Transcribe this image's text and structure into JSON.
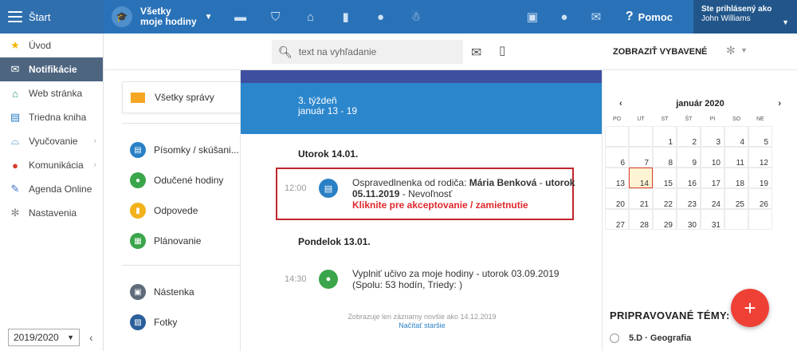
{
  "topbar": {
    "start_label": "Štart",
    "subject_line1": "Všetky",
    "subject_line2": "moje hodiny",
    "help_label": "Pomoc",
    "user_line1": "Ste prihlásený ako",
    "user_line2": "John Williams"
  },
  "sidebar": {
    "items": [
      {
        "label": "Úvod",
        "icon": "star-icon"
      },
      {
        "label": "Notifikácie",
        "icon": "envelope-icon"
      },
      {
        "label": "Web stránka",
        "icon": "home-icon"
      },
      {
        "label": "Triedna kniha",
        "icon": "book-icon"
      },
      {
        "label": "Vyučovanie",
        "icon": "bridge-icon"
      },
      {
        "label": "Komunikácia",
        "icon": "chat-icon"
      },
      {
        "label": "Agenda Online",
        "icon": "pen-icon"
      },
      {
        "label": "Nastavenia",
        "icon": "gear-icon"
      }
    ],
    "year": "2019/2020"
  },
  "subheader": {
    "search_placeholder": "text na vyhľadanie",
    "show_equipment": "ZOBRAZIŤ VYBAVENÉ"
  },
  "categories": {
    "all_messages": "Všetky správy",
    "items": [
      {
        "label": "Písomky / skúšani...",
        "color": "#2a80c5"
      },
      {
        "label": "Odučené hodiny",
        "color": "#3aa54a"
      },
      {
        "label": "Odpovede",
        "color": "#f2b21c"
      },
      {
        "label": "Plánovanie",
        "color": "#3aa54a"
      },
      {
        "label": "Nástenka",
        "color": "#5e6b78"
      },
      {
        "label": "Fotky",
        "color": "#2a5f9a"
      }
    ]
  },
  "feed": {
    "week_label": "3. týždeň",
    "week_range": "január 13 - 19",
    "days": [
      {
        "title": "Utorok 14.01.",
        "entry": {
          "time": "12:00",
          "text_prefix": "Ospravedlnenka od rodiča: ",
          "name": "Mária Benková",
          "text_mid": " - ",
          "date": "utorok 05.11.2019",
          "text_suffix": " - Nevoľnosť",
          "action": "Kliknite pre akceptovanie / zamietnutie"
        }
      },
      {
        "title": "Pondelok 13.01.",
        "entry": {
          "time": "14:30",
          "text": "Vyplniť učivo za moje hodiny - utorok 03.09.2019 (Spolu: 53 hodín, Triedy: )"
        }
      }
    ],
    "notice": "Zobrazuje len záznamy novšie ako 14.12.2019",
    "load_older": "Načítať staršie"
  },
  "calendar": {
    "month": "január 2020",
    "prev": "‹",
    "next": "›",
    "weekdays": [
      "PO",
      "UT",
      "ST",
      "ŠT",
      "PI",
      "SO",
      "NE"
    ],
    "weeks": [
      [
        "",
        "",
        "1",
        "2",
        "3",
        "4",
        "5"
      ],
      [
        "6",
        "7",
        "8",
        "9",
        "10",
        "11",
        "12"
      ],
      [
        "13",
        "14",
        "15",
        "16",
        "17",
        "18",
        "19"
      ],
      [
        "20",
        "21",
        "22",
        "23",
        "24",
        "25",
        "26"
      ],
      [
        "27",
        "28",
        "29",
        "30",
        "31",
        "",
        ""
      ]
    ],
    "today": "14"
  },
  "topics": {
    "title": "PRIPRAVOVANÉ TÉMY:",
    "first": "5.D · Geografia"
  }
}
